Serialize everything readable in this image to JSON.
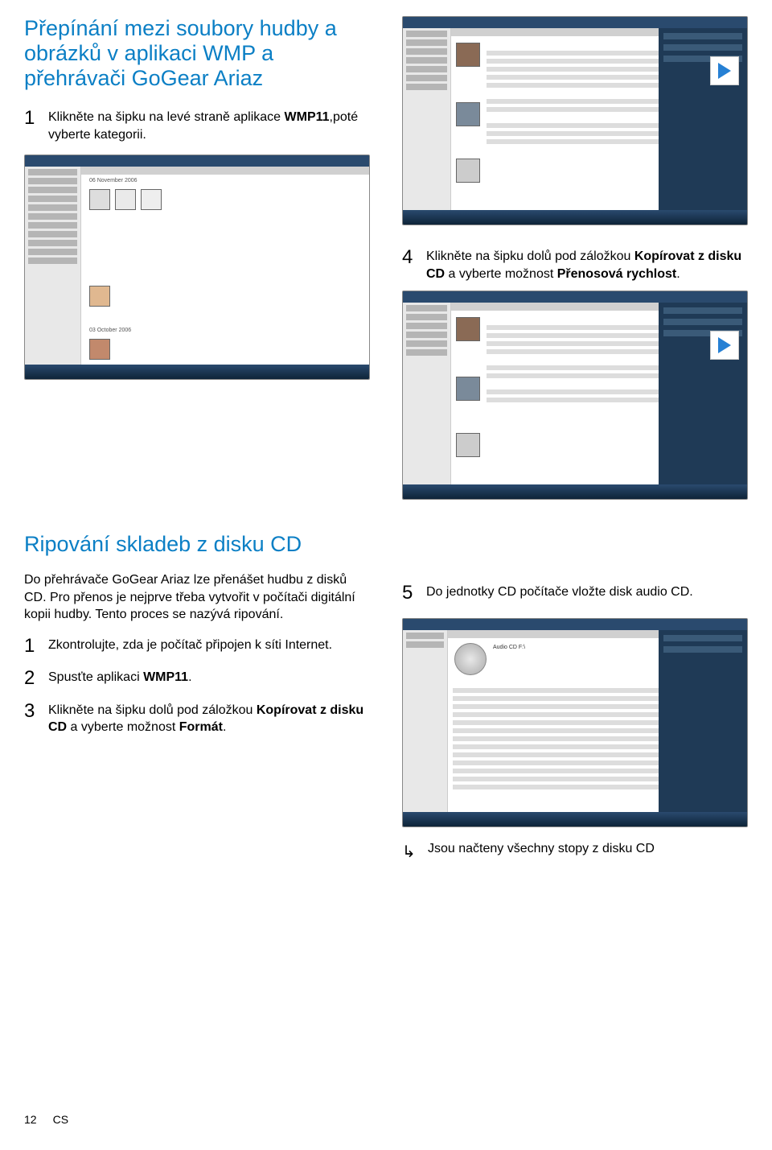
{
  "section1": {
    "title": "Přepínání mezi soubory hudby a obrázků v aplikaci WMP a přehrávači GoGear Ariaz",
    "step1_num": "1",
    "step1_a": "Klikněte na šipku na levé straně aplikace ",
    "step1_b": "WMP11",
    "step1_c": ",poté vyberte kategorii.",
    "step4_num": "4",
    "step4_a": "Klikněte na šipku dolů pod záložkou ",
    "step4_b": "Kopírovat z disku CD",
    "step4_c": " a vyberte možnost ",
    "step4_d": "Přenosová rychlost",
    "step4_e": "."
  },
  "section2": {
    "title": "Ripování skladeb z disku CD",
    "intro": "Do přehrávače GoGear Ariaz lze přenášet hudbu z disků CD. Pro přenos je nejprve třeba vytvořit v počítači digitální kopii hudby. Tento proces se nazývá ripování.",
    "step1_num": "1",
    "step1": "Zkontrolujte, zda je počítač připojen k síti Internet.",
    "step2_num": "2",
    "step2_a": "Spusťte aplikaci ",
    "step2_b": "WMP11",
    "step2_c": ".",
    "step3_num": "3",
    "step3_a": "Klikněte na šipku dolů pod záložkou ",
    "step3_b": "Kopírovat z disku CD",
    "step3_c": " a vyberte možnost ",
    "step3_d": "Formát",
    "step3_e": ".",
    "step5_num": "5",
    "step5": "Do jednotky CD počítače vložte disk audio CD.",
    "result_arrow": "↳",
    "result": "Jsou načteny všechny stopy z disku CD"
  },
  "footer": {
    "page": "12",
    "lang": "CS"
  }
}
